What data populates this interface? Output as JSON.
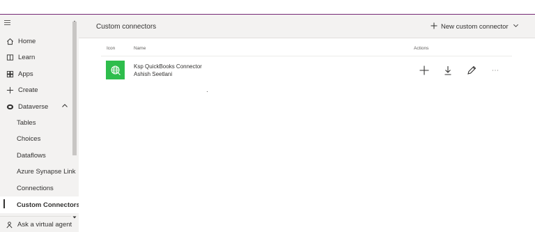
{
  "sidebar": {
    "items": [
      {
        "label": "Home",
        "icon": "home-icon"
      },
      {
        "label": "Learn",
        "icon": "book-icon"
      },
      {
        "label": "Apps",
        "icon": "apps-icon"
      },
      {
        "label": "Create",
        "icon": "plus-icon"
      },
      {
        "label": "Dataverse",
        "icon": "database-icon",
        "expanded": true
      },
      {
        "label": "Tables"
      },
      {
        "label": "Choices"
      },
      {
        "label": "Dataflows"
      },
      {
        "label": "Azure Synapse Link"
      },
      {
        "label": "Connections"
      },
      {
        "label": "Custom Connectors",
        "active": true
      }
    ],
    "ask_agent_label": "Ask a virtual agent"
  },
  "header": {
    "title": "Custom connectors",
    "new_button_label": "New custom connector"
  },
  "table": {
    "columns": {
      "icon": "Icon",
      "name": "Name",
      "actions": "Actions"
    },
    "rows": [
      {
        "name": "Ksp QuickBooks Connector",
        "owner": "Ashish Seetlani",
        "icon_color": "#2ebd4c"
      }
    ]
  },
  "colors": {
    "accent": "#742774",
    "connector_icon": "#2ebd4c",
    "sidebar_bg": "#f3f2f1"
  }
}
